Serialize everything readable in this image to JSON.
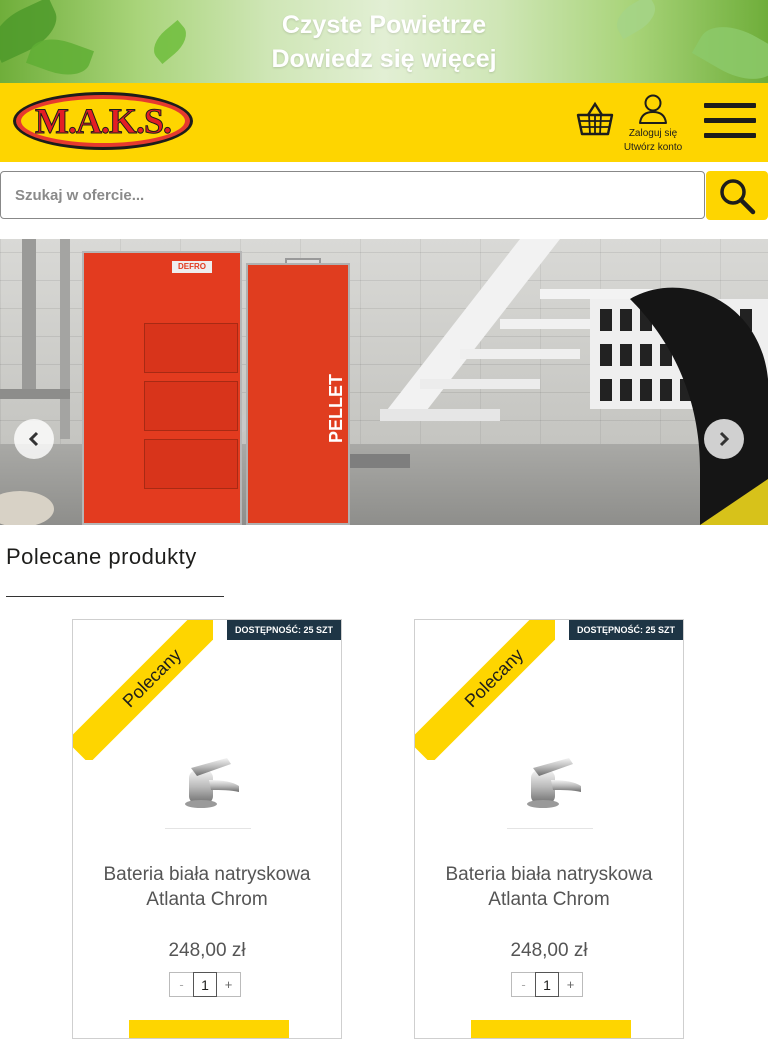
{
  "promo": {
    "line1": "Czyste Powietrze",
    "line2": "Dowiedz się więcej"
  },
  "header": {
    "logo_text": "M.A.K.S.",
    "account_login": "Zaloguj się",
    "account_register": "Utwórz konto"
  },
  "search": {
    "placeholder": "Szukaj w ofercie..."
  },
  "hero": {
    "boiler_brand": "DEFRO",
    "pellet_label": "PELLET"
  },
  "section": {
    "title": "Polecane produkty"
  },
  "products": [
    {
      "badge": "DOSTĘPNOŚĆ: 25 SZT",
      "ribbon": "Polecany",
      "name": "Bateria biała natryskowa Atlanta Chrom",
      "price": "248,00 zł",
      "qty": "1",
      "minus": "-",
      "plus": "+"
    },
    {
      "badge": "DOSTĘPNOŚĆ: 25 SZT",
      "ribbon": "Polecany",
      "name": "Bateria biała natryskowa Atlanta Chrom",
      "price": "248,00 zł",
      "qty": "1",
      "minus": "-",
      "plus": "+"
    }
  ],
  "colors": {
    "brand_yellow": "#fed500",
    "logo_red": "#e31e24",
    "badge_navy": "#1e3545"
  }
}
